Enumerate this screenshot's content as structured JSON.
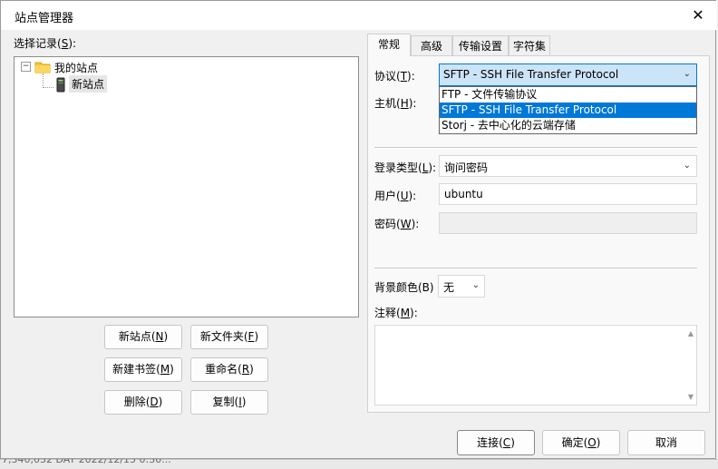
{
  "dialog": {
    "title": "站点管理器",
    "close_glyph": "✕"
  },
  "left": {
    "select_label": "选择记录(",
    "select_key": "S",
    "select_end": "):",
    "tree": {
      "folder_label": "我的站点",
      "site_label": "新站点",
      "expander": "−"
    },
    "buttons": {
      "new_site": [
        "新站点(",
        "N",
        ")"
      ],
      "new_folder": [
        "新文件夹(",
        "F",
        ")"
      ],
      "new_bookmark": [
        "新建书签(",
        "M",
        ")"
      ],
      "rename": [
        "重命名(",
        "R",
        ")"
      ],
      "delete": [
        "删除(",
        "D",
        ")"
      ],
      "copy": [
        "复制(",
        "I",
        ")"
      ]
    }
  },
  "tabs": [
    "常规",
    "高级",
    "传输设置",
    "字符集"
  ],
  "general": {
    "protocol_label": [
      "协议(",
      "T",
      "):"
    ],
    "protocol_value": "SFTP - SSH File Transfer Protocol",
    "protocol_options": [
      "FTP - 文件传输协议",
      "SFTP - SSH File Transfer Protocol",
      "Storj - 去中心化的云端存储"
    ],
    "host_label": [
      "主机(",
      "H",
      "):"
    ],
    "logon_type_label": [
      "登录类型(",
      "L",
      "):"
    ],
    "logon_type_value": "询问密码",
    "user_label": [
      "用户(",
      "U",
      "):"
    ],
    "user_value": "ubuntu",
    "password_label": [
      "密码(",
      "W",
      "):"
    ],
    "bg_color_label": "背景颜色(B)",
    "bg_color_value": "无",
    "comments_label": [
      "注释(",
      "M",
      "):"
    ]
  },
  "footer": {
    "connect": [
      "连接(",
      "C",
      ")"
    ],
    "ok": [
      "确定(",
      "O",
      ")"
    ],
    "cancel": "取消"
  },
  "background": {
    "bottom_row": "7,340,032   DAT            2022/12/15 0:30..."
  }
}
